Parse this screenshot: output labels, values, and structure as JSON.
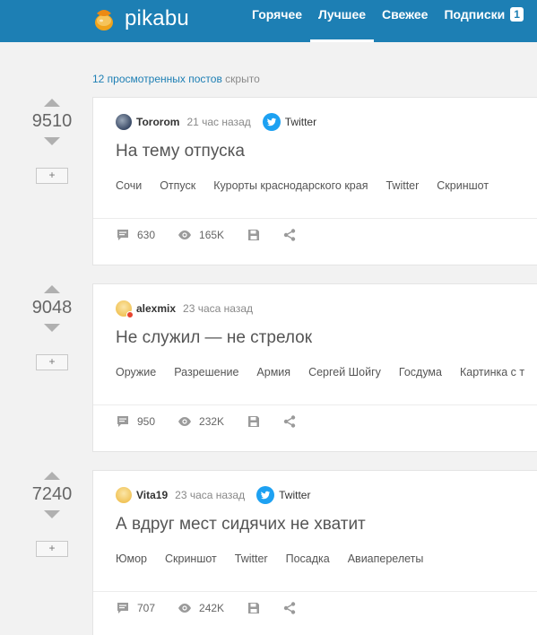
{
  "header": {
    "logo_text": "pikabu",
    "nav": [
      {
        "label": "Горячее",
        "active": false
      },
      {
        "label": "Лучшее",
        "active": true
      },
      {
        "label": "Свежее",
        "active": false
      },
      {
        "label": "Подписки",
        "active": false,
        "badge": "1"
      }
    ],
    "brand_color": "#1d7fb4"
  },
  "hidden_posts": {
    "link_text": "12 просмотренных постов",
    "rest_text": " скрыто"
  },
  "posts": [
    {
      "rating": "9510",
      "save_label": "+",
      "author": "Tororom",
      "time": "21 час назад",
      "community": "Twitter",
      "title": "На тему отпуска",
      "tags": [
        "Сочи",
        "Отпуск",
        "Курорты краснодарского края",
        "Twitter",
        "Скриншот"
      ],
      "comments": "630",
      "views": "165K"
    },
    {
      "rating": "9048",
      "save_label": "+",
      "author": "alexmix",
      "time": "23 часа назад",
      "community": "",
      "title": "Не служил — не стрелок",
      "tags": [
        "Оружие",
        "Разрешение",
        "Армия",
        "Сергей Шойгу",
        "Госдума",
        "Картинка с т"
      ],
      "comments": "950",
      "views": "232K"
    },
    {
      "rating": "7240",
      "save_label": "+",
      "author": "Vita19",
      "time": "23 часа назад",
      "community": "Twitter",
      "title": "А вдруг мест сидячих не хватит",
      "tags": [
        "Юмор",
        "Скриншот",
        "Twitter",
        "Посадка",
        "Авиаперелеты"
      ],
      "comments": "707",
      "views": "242K"
    }
  ]
}
